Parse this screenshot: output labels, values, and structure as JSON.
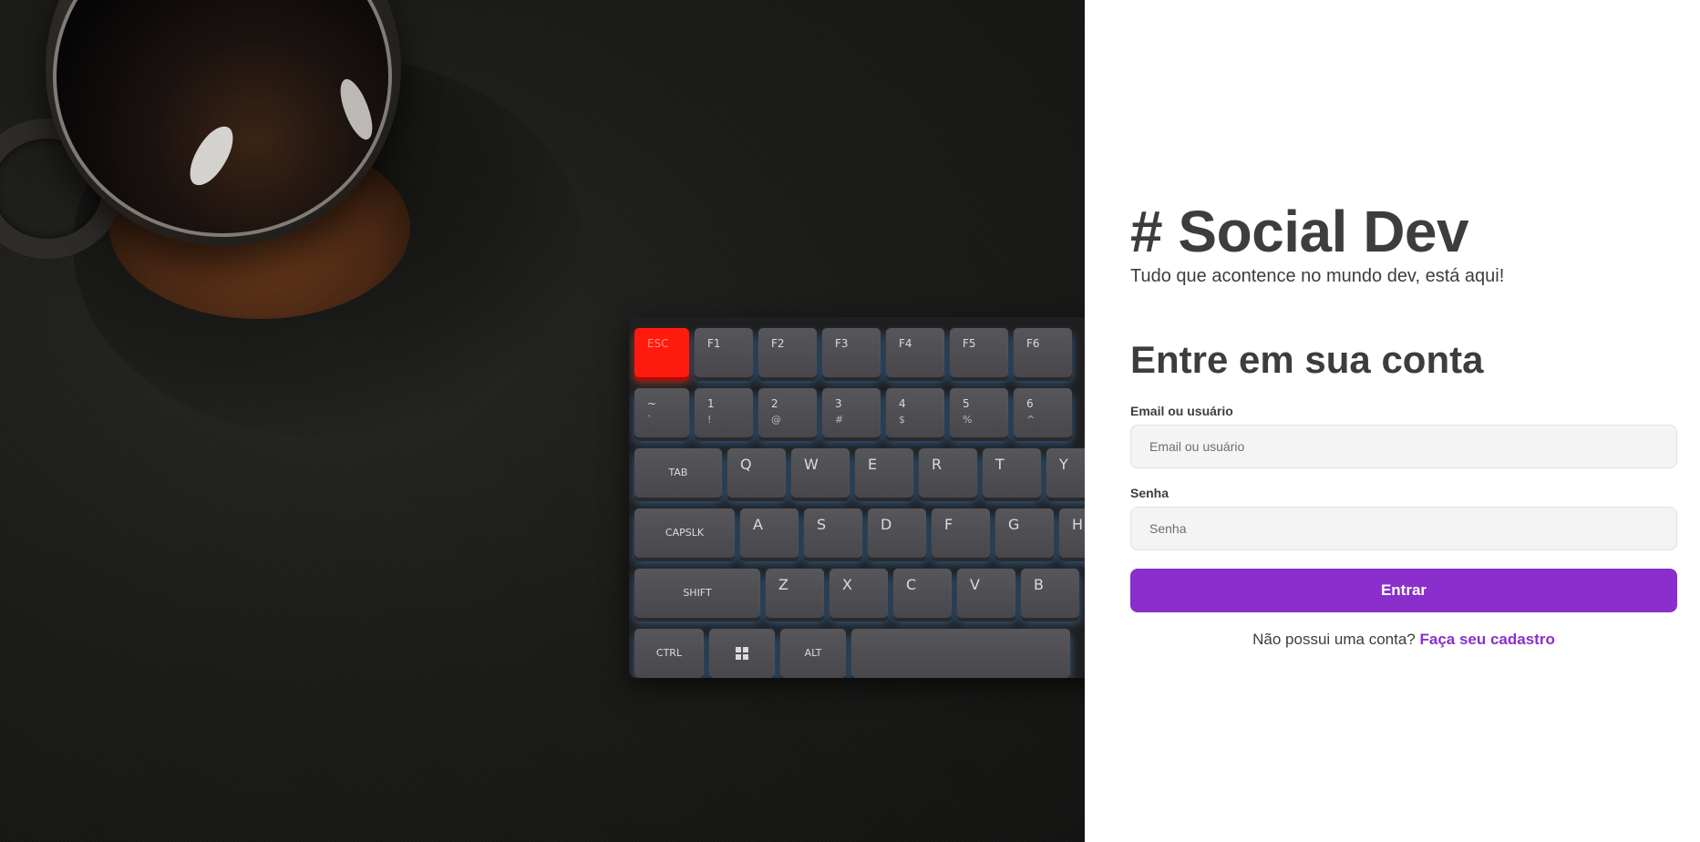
{
  "hero": {
    "image_alt": "Caneca de café ao lado de um teclado mecânico com iluminação azul",
    "keyboard": {
      "row_function": [
        "ESC",
        "F1",
        "F2",
        "F3",
        "F4",
        "F5",
        "F6"
      ],
      "row_number": [
        {
          "main": "~",
          "shift": "`"
        },
        {
          "main": "1",
          "shift": "!"
        },
        {
          "main": "2",
          "shift": "@"
        },
        {
          "main": "3",
          "shift": "#"
        },
        {
          "main": "4",
          "shift": "$"
        },
        {
          "main": "5",
          "shift": "%"
        },
        {
          "main": "6",
          "shift": "^"
        }
      ],
      "tab_label": "TAB",
      "row_qwerty": [
        "Q",
        "W",
        "E",
        "R",
        "T",
        "Y"
      ],
      "capslock_label": "CAPSLK",
      "row_asdf": [
        "A",
        "S",
        "D",
        "F",
        "G",
        "H"
      ],
      "shift_label": "SHIFT",
      "row_zxcv": [
        "Z",
        "X",
        "C",
        "V",
        "B"
      ],
      "ctrl_label": "CTRL",
      "alt_label": "ALT"
    }
  },
  "brand": {
    "title": "# Social Dev",
    "tagline": "Tudo que acontence no mundo dev, está aqui!"
  },
  "login": {
    "title": "Entre em sua conta",
    "email_label": "Email ou usuário",
    "email_placeholder": "Email ou usuário",
    "email_value": "",
    "password_label": "Senha",
    "password_placeholder": "Senha",
    "password_value": "",
    "submit_label": "Entrar",
    "signup_prompt": "Não possui uma conta?",
    "signup_link": "Faça seu cadastro"
  },
  "colors": {
    "accent": "#8a2fcb",
    "text": "#3d3d3d",
    "input_bg": "#f4f4f4",
    "hero_bg": "#1b1b19"
  }
}
